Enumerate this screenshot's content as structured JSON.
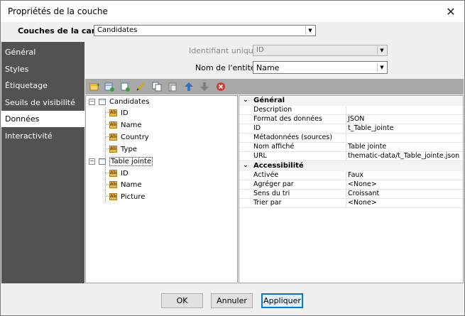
{
  "window": {
    "title": "Propriétés de la couche",
    "close_glyph": "✕"
  },
  "layers": {
    "label": "Couches de la carte:",
    "selected": "Candidates"
  },
  "sidebar": {
    "items": [
      {
        "label": "Général"
      },
      {
        "label": "Styles"
      },
      {
        "label": "Étiquetage"
      },
      {
        "label": "Seuils de visibilité"
      },
      {
        "label": "Données",
        "selected": true
      },
      {
        "label": "Interactivité"
      }
    ]
  },
  "fields": {
    "unique_id_label": "Identifiant unique:",
    "unique_id_value": "ID",
    "entity_name_label": "Nom de l'entité:",
    "entity_name_value": "Name"
  },
  "toolbar": {
    "icons": [
      "add-table-icon",
      "add-join-icon",
      "add-field-icon",
      "edit-icon",
      "copy-icon",
      "paste-icon",
      "move-up-icon",
      "move-down-icon",
      "delete-icon"
    ]
  },
  "tree": {
    "tables": [
      {
        "name": "Candidates",
        "fields": [
          "ID",
          "Name",
          "Country",
          "Type"
        ]
      },
      {
        "name": "Table jointe",
        "fields": [
          "ID",
          "Name",
          "Picture"
        ]
      }
    ]
  },
  "properties": {
    "general": {
      "title": "Général",
      "rows": [
        {
          "key": "Description",
          "value": ""
        },
        {
          "key": "Format des données",
          "value": "JSON"
        },
        {
          "key": "ID",
          "value": "t_Table_jointe"
        },
        {
          "key": "Métadonnées (sources)",
          "value": ""
        },
        {
          "key": "Nom affiché",
          "value": "Table jointe"
        },
        {
          "key": "URL",
          "value": "thematic-data/t_Table_jointe.json"
        }
      ]
    },
    "accessibility": {
      "title": "Accessibilité",
      "rows": [
        {
          "key": "Activée",
          "value": "Faux"
        },
        {
          "key": "Agréger par",
          "value": "<None>"
        },
        {
          "key": "Sens du tri",
          "value": "Croissant"
        },
        {
          "key": "Trier par",
          "value": "<None>"
        }
      ]
    }
  },
  "buttons": {
    "ok": "OK",
    "cancel": "Annuler",
    "apply": "Appliquer"
  },
  "colors": {
    "sidebar_bg": "#525252",
    "toolbar_bg": "#a8a8a8",
    "accent": "#0078d7"
  }
}
